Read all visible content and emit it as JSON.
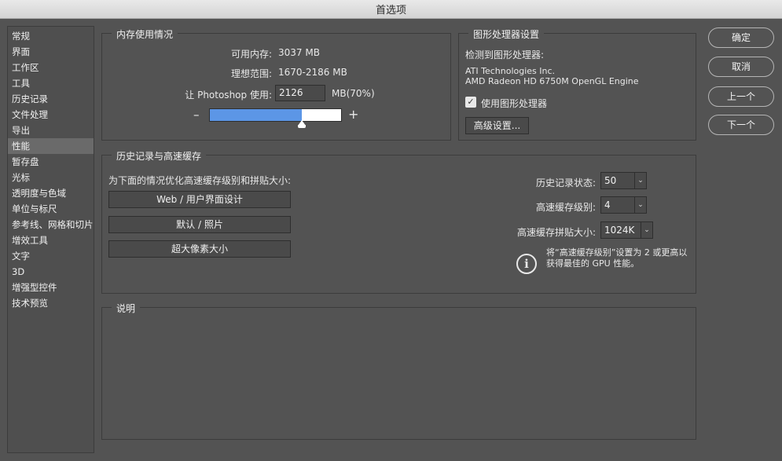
{
  "window": {
    "title": "首选项"
  },
  "sidebar": {
    "items": [
      {
        "label": "常规"
      },
      {
        "label": "界面"
      },
      {
        "label": "工作区"
      },
      {
        "label": "工具"
      },
      {
        "label": "历史记录"
      },
      {
        "label": "文件处理"
      },
      {
        "label": "导出"
      },
      {
        "label": "性能",
        "active": true
      },
      {
        "label": "暂存盘"
      },
      {
        "label": "光标"
      },
      {
        "label": "透明度与色域"
      },
      {
        "label": "单位与标尺"
      },
      {
        "label": "参考线、网格和切片"
      },
      {
        "label": "增效工具"
      },
      {
        "label": "文字"
      },
      {
        "label": "3D"
      },
      {
        "label": "增强型控件"
      },
      {
        "label": "技术预览"
      }
    ]
  },
  "memory": {
    "title": "内存使用情况",
    "available_label": "可用内存:",
    "available_value": "3037 MB",
    "ideal_label": "理想范围:",
    "ideal_value": "1670-2186 MB",
    "use_label": "让 Photoshop 使用:",
    "use_value": "2126",
    "use_suffix": "MB(70%)",
    "minus": "–",
    "plus": "+",
    "slider_fraction": 0.7
  },
  "gpu": {
    "title": "图形处理器设置",
    "detected_label": "检测到图形处理器:",
    "vendor": "ATI Technologies Inc.",
    "model": "AMD Radeon HD 6750M OpenGL Engine",
    "use_gpu_label": "使用图形处理器",
    "use_gpu_checked": true,
    "advanced_button": "高级设置..."
  },
  "history_cache": {
    "title": "历史记录与高速缓存",
    "optimize_label": "为下面的情况优化高速缓存级别和拼贴大小:",
    "preset_buttons": [
      "Web / 用户界面设计",
      "默认 / 照片",
      "超大像素大小"
    ],
    "history_states_label": "历史记录状态:",
    "history_states_value": "50",
    "cache_levels_label": "高速缓存级别:",
    "cache_levels_value": "4",
    "tile_size_label": "高速缓存拼贴大小:",
    "tile_size_value": "1024K",
    "info_line1": "将“高速缓存级别”设置为 2 或更高以",
    "info_line2": "获得最佳的 GPU 性能。"
  },
  "description": {
    "title": "说明"
  },
  "buttons": {
    "ok": "确定",
    "cancel": "取消",
    "prev": "上一个",
    "next": "下一个"
  },
  "colors": {
    "slider_fill": "#5c96e6",
    "panel_bg": "#535353"
  }
}
